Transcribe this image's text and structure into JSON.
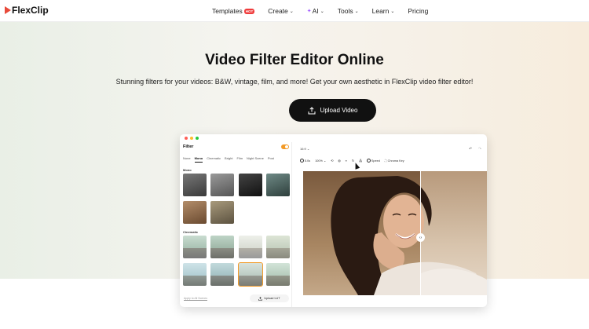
{
  "nav": {
    "logo_text": "FlexClip",
    "items": [
      {
        "label": "Templates",
        "badge": "HOT",
        "chevron": false
      },
      {
        "label": "Create",
        "chevron": true
      },
      {
        "label": "AI",
        "chevron": true
      },
      {
        "label": "Tools",
        "chevron": true
      },
      {
        "label": "Learn",
        "chevron": true
      },
      {
        "label": "Pricing",
        "chevron": false
      }
    ]
  },
  "hero": {
    "title": "Video Filter Editor Online",
    "subtitle": "Stunning filters for your videos: B&W, vintage, film, and more! Get your own aesthetic in FlexClip video filter editor!",
    "upload_label": "Upload Video"
  },
  "app": {
    "panel_title": "Filter",
    "tabs": [
      "None",
      "Mono",
      "Cinematic",
      "Bright",
      "Film",
      "Night Scene",
      "Post"
    ],
    "active_tab": "Mono",
    "sections": {
      "mono": "Mono",
      "cinematic": "Cinematic"
    },
    "apply_all": "Apply to All Scenes",
    "upload_lut": "Upload LUT",
    "ratio": "16:9",
    "toolbar": {
      "duration": "5.0s",
      "zoom": "100%",
      "speed": "Speed",
      "chroma": "Chroma Key"
    }
  },
  "colors": {
    "accent": "#f29a27",
    "brand_red": "#e84a3a",
    "button_dark": "#111111"
  }
}
